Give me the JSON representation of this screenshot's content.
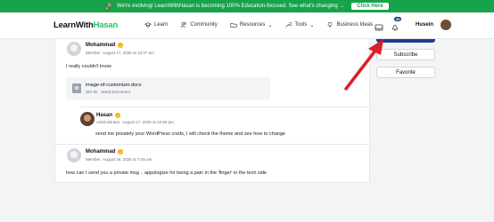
{
  "banner": {
    "text": "We're evolving! LearnWithHasan is becoming 100% Education-focused. See what's changing →",
    "cta": "Click Here",
    "rocket_icon": "rocket-icon"
  },
  "nav": {
    "logo_main": "LearnWith",
    "logo_accent": "Hasan",
    "items": [
      {
        "label": "Learn",
        "icon": "graduation-cap-icon"
      },
      {
        "label": "Community",
        "icon": "users-icon"
      },
      {
        "label": "Resources",
        "icon": "folder-icon"
      },
      {
        "label": "Tools",
        "icon": "wrench-icon"
      },
      {
        "label": "Business Ideas",
        "icon": "lightbulb-icon"
      }
    ],
    "notifications": "99",
    "user_name": "Husein"
  },
  "sidebar": {
    "subscribe": "Subscribe",
    "favorite": "Favorite"
  },
  "comments": [
    {
      "author": "Mohammad",
      "role": "Member",
      "date": "August 17, 2025 at 10:27 am",
      "text": "I really couldn't know",
      "attachment": {
        "name": "image-of-customizer.docx",
        "size": "357 kb · Word Document",
        "icon_letter": "W"
      }
    },
    {
      "author": "Hasan",
      "role": "Administrator",
      "date": "August 17, 2025 at 10:55 pm",
      "text": "send me privately your WordPress creds, I will check the theme and see how to change"
    },
    {
      "author": "Mohammad",
      "role": "Member",
      "date": "August 18, 2025 at 7:45 am",
      "text": "how can I send you a private msg .. appologize for being a pain in the 'finger' in the tech side"
    }
  ],
  "colors": {
    "brand_green": "#22c55e",
    "banner_green": "#16a34a",
    "navy": "#1e3a8a",
    "arrow_red": "#e11d2a",
    "verified": "#f5b400"
  }
}
